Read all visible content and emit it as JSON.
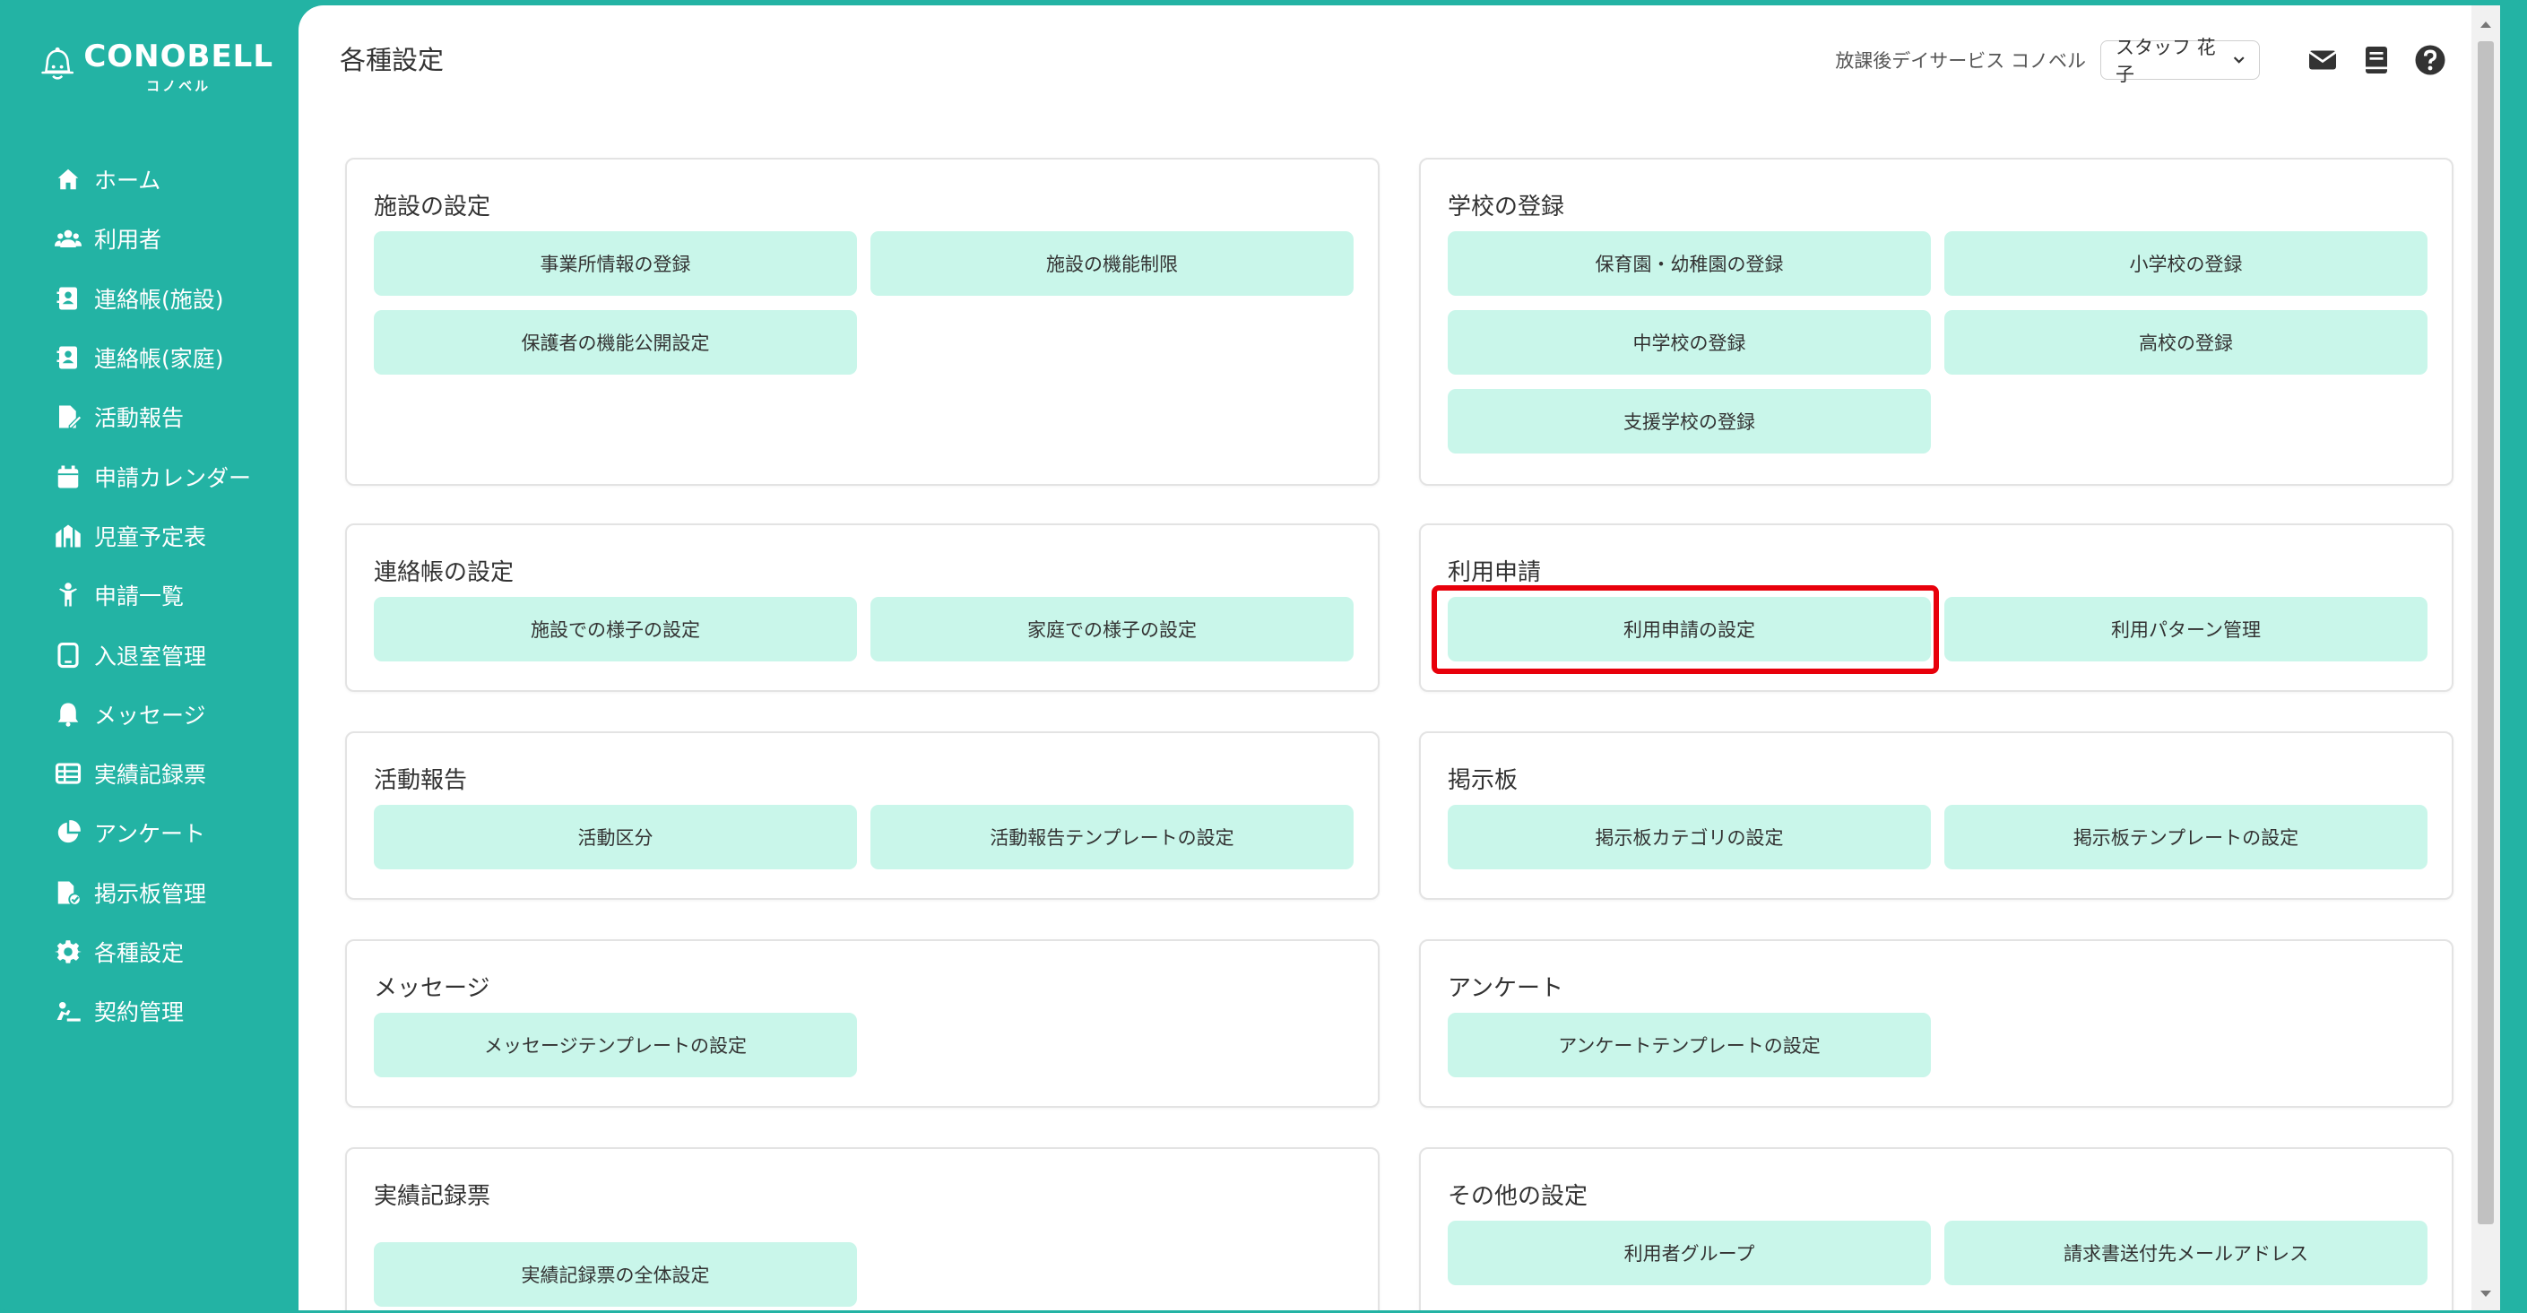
{
  "app": {
    "logo_text": "CONOBELL",
    "logo_sub": "コノベル"
  },
  "sidebar": {
    "items": [
      {
        "label": "ホーム",
        "icon": "home-icon"
      },
      {
        "label": "利用者",
        "icon": "users-icon"
      },
      {
        "label": "連絡帳(施設)",
        "icon": "contact-book-icon"
      },
      {
        "label": "連絡帳(家庭)",
        "icon": "contact-book-icon"
      },
      {
        "label": "活動報告",
        "icon": "report-edit-icon"
      },
      {
        "label": "申請カレンダー",
        "icon": "calendar-icon"
      },
      {
        "label": "児童予定表",
        "icon": "schedule-icon"
      },
      {
        "label": "申請一覧",
        "icon": "child-icon"
      },
      {
        "label": "入退室管理",
        "icon": "tablet-icon"
      },
      {
        "label": "メッセージ",
        "icon": "bell-icon"
      },
      {
        "label": "実績記録票",
        "icon": "table-icon"
      },
      {
        "label": "アンケート",
        "icon": "pie-chart-icon"
      },
      {
        "label": "掲示板管理",
        "icon": "board-icon"
      },
      {
        "label": "各種設定",
        "icon": "gear-icon"
      },
      {
        "label": "契約管理",
        "icon": "contract-icon"
      }
    ]
  },
  "header": {
    "title": "各種設定",
    "facility_name": "放課後デイサービス コノベル",
    "staff_selected": "スタッフ 花子"
  },
  "cards": {
    "facility": {
      "title": "施設の設定",
      "buttons": [
        "事業所情報の登録",
        "施設の機能制限",
        "保護者の機能公開設定"
      ]
    },
    "school": {
      "title": "学校の登録",
      "buttons": [
        "保育園・幼稚園の登録",
        "小学校の登録",
        "中学校の登録",
        "高校の登録",
        "支援学校の登録"
      ]
    },
    "contact": {
      "title": "連絡帳の設定",
      "buttons": [
        "施設での様子の設定",
        "家庭での様子の設定"
      ]
    },
    "usage": {
      "title": "利用申請",
      "buttons": [
        "利用申請の設定",
        "利用パターン管理"
      ]
    },
    "activity": {
      "title": "活動報告",
      "buttons": [
        "活動区分",
        "活動報告テンプレートの設定"
      ]
    },
    "board": {
      "title": "掲示板",
      "buttons": [
        "掲示板カテゴリの設定",
        "掲示板テンプレートの設定"
      ]
    },
    "message": {
      "title": "メッセージ",
      "buttons": [
        "メッセージテンプレートの設定"
      ]
    },
    "survey": {
      "title": "アンケート",
      "buttons": [
        "アンケートテンプレートの設定"
      ]
    },
    "record": {
      "title": "実績記録票",
      "buttons": [
        "実績記録票の全体設定"
      ]
    },
    "other": {
      "title": "その他の設定",
      "buttons": [
        "利用者グループ",
        "請求書送付先メールアドレス"
      ]
    }
  },
  "colors": {
    "brand": "#23b3a4",
    "button_bg": "#c9f6ea",
    "highlight": "#e8000b"
  }
}
